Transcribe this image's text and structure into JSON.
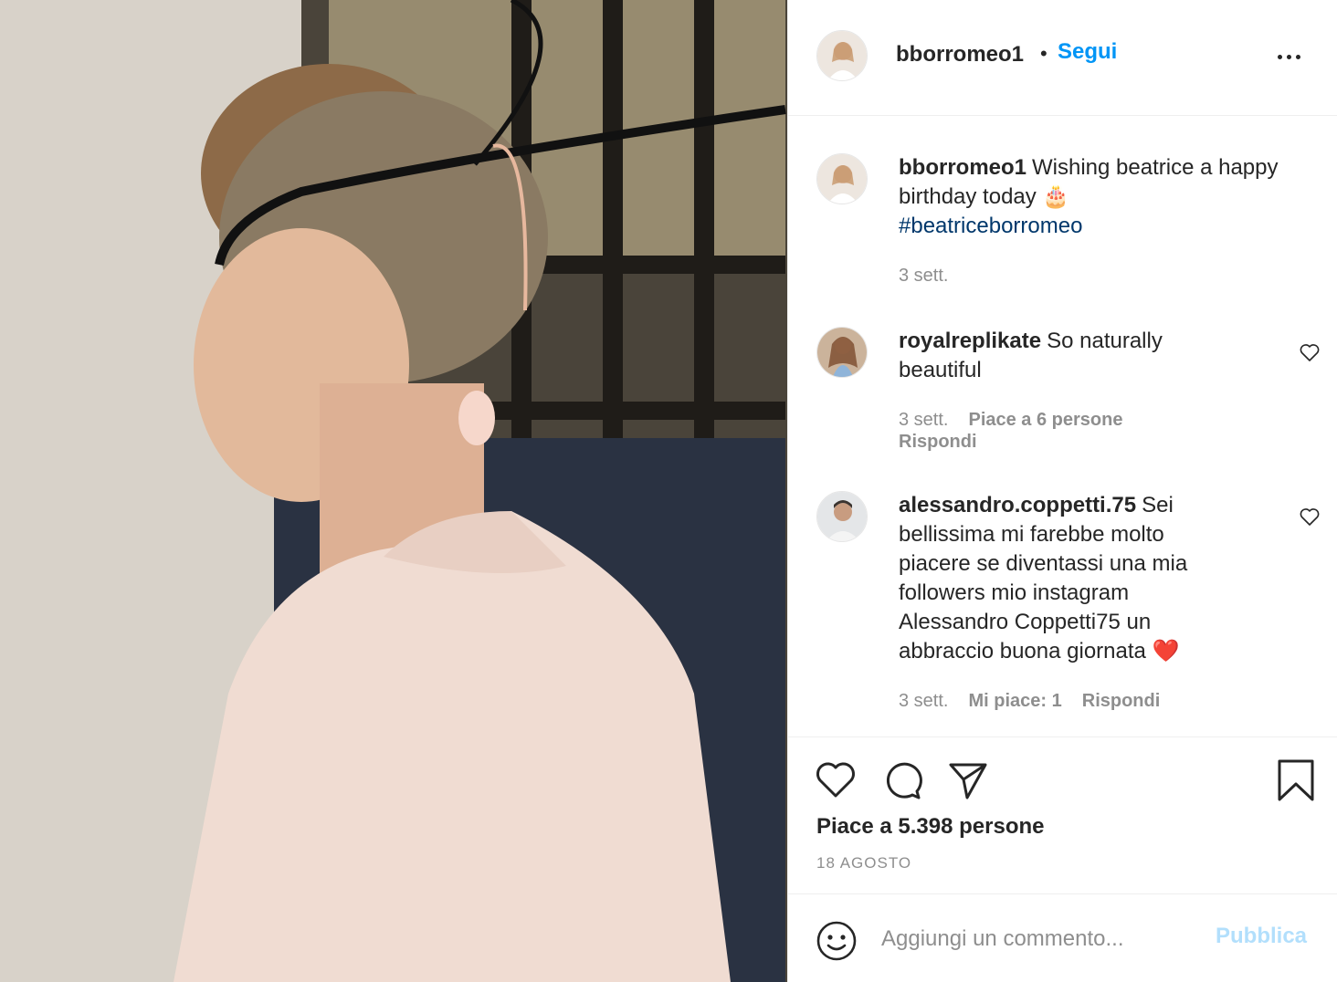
{
  "post": {
    "image_alt": "photo",
    "author": "bborromeo1",
    "follow_label": "Segui",
    "separator": "•"
  },
  "caption": {
    "handle": "bborromeo1",
    "text": "Wishing beatrice a happy birthday today 🎂",
    "hashtag": "#beatriceborromeo",
    "time": "3 sett."
  },
  "comments": [
    {
      "handle": "royalreplikate",
      "text": "So naturally beautiful",
      "time": "3 sett.",
      "likes": "Piace a 6 persone",
      "reply": "Rispondi"
    },
    {
      "handle": "alessandro.coppetti.75",
      "text": "Sei bellissima mi farebbe molto piacere se diventassi una mia followers mio instagram Alessandro Coppetti75 un abbraccio buona giornata ❤️",
      "time": "3 sett.",
      "likes": "Mi piace: 1",
      "reply": "Rispondi"
    }
  ],
  "actions": {
    "icons": [
      "heart-icon",
      "comment-icon",
      "share-icon",
      "bookmark-icon"
    ],
    "likes_label": "Piace a 5.398 persone",
    "date": "18 agosto"
  },
  "add_comment": {
    "placeholder": "Aggiungi un commento...",
    "publish_label": "Pubblica"
  },
  "colors": {
    "link": "#0095f6",
    "hashtag": "#00376b",
    "muted": "#8e8e8e",
    "publish_disabled": "#b2dffc"
  }
}
